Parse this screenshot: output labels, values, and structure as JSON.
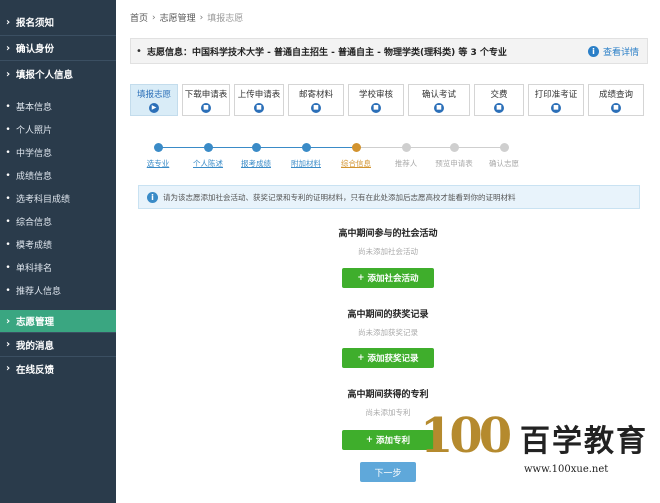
{
  "sidebar": {
    "top_items": [
      {
        "label": "报名须知"
      },
      {
        "label": "确认身份"
      },
      {
        "label": "填报个人信息"
      }
    ],
    "sub_items": [
      {
        "label": "基本信息"
      },
      {
        "label": "个人照片"
      },
      {
        "label": "中学信息"
      },
      {
        "label": "成绩信息"
      },
      {
        "label": "选考科目成绩"
      },
      {
        "label": "综合信息"
      },
      {
        "label": "模考成绩"
      },
      {
        "label": "单科排名"
      },
      {
        "label": "推荐人信息"
      }
    ],
    "bottom_items": [
      {
        "label": "志愿管理",
        "active": true
      },
      {
        "label": "我的消息"
      },
      {
        "label": "在线反馈"
      }
    ]
  },
  "breadcrumb": {
    "home": "首页",
    "section": "志愿管理",
    "current": "填报志愿"
  },
  "infobar": {
    "text": "志愿信息：中国科学技术大学 - 普通自主招生 - 普通自主 - 物理学类(理科类) 等 3 个专业",
    "detail_label": "查看详情"
  },
  "tabs": [
    {
      "label": "填报志愿",
      "active": true
    },
    {
      "label": "下载申请表"
    },
    {
      "label": "上传申请表"
    },
    {
      "label": "邮寄材料"
    },
    {
      "label": "学校审核"
    },
    {
      "label": "确认考试"
    },
    {
      "label": "交费"
    },
    {
      "label": "打印准考证"
    },
    {
      "label": "成绩查询"
    }
  ],
  "steps": [
    {
      "label": "选专业",
      "state": "done"
    },
    {
      "label": "个人陈述",
      "state": "done"
    },
    {
      "label": "报考成绩",
      "state": "done"
    },
    {
      "label": "附加材料",
      "state": "done"
    },
    {
      "label": "综合信息",
      "state": "current"
    },
    {
      "label": "推荐人",
      "state": "todo"
    },
    {
      "label": "预览申请表",
      "state": "todo"
    },
    {
      "label": "确认志愿",
      "state": "todo"
    }
  ],
  "colors": {
    "sidebar_bg": "#2a3b4b",
    "active_green": "#3aa681",
    "button_green": "#3fae2c",
    "step_done": "#3a8bc7",
    "step_current": "#d2932f",
    "step_todo": "#cfcfcf"
  },
  "notice": {
    "text": "请为该志愿添加社会活动、获奖记录和专利的证明材料，只有在此处添加后志愿高校才能看到你的证明材料"
  },
  "sections": [
    {
      "title": "高中期间参与的社会活动",
      "empty": "尚未添加社会活动",
      "button": "添加社会活动"
    },
    {
      "title": "高中期间的获奖记录",
      "empty": "尚未添加获奖记录",
      "button": "添加获奖记录"
    },
    {
      "title": "高中期间获得的专利",
      "empty": "尚未添加专利",
      "button": "添加专利"
    }
  ],
  "next_button": "下一步",
  "watermark": {
    "number": "100",
    "name": "百学教育",
    "url": "www.100xue.net"
  }
}
